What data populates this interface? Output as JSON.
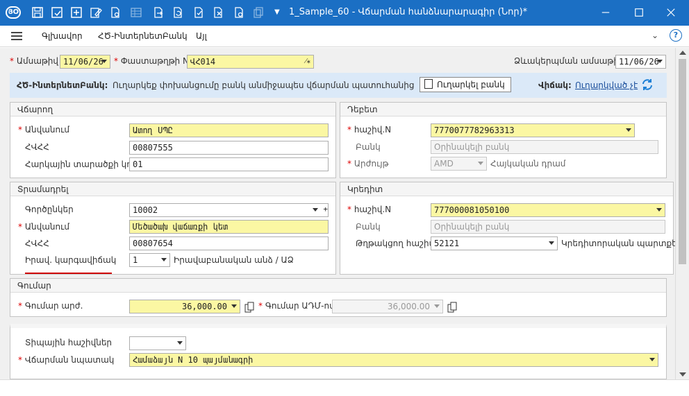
{
  "window": {
    "title": "1_Sample_60 - Վճարման հանձնարարագիր (Նոր)*",
    "logo_text": "ՅՕ"
  },
  "menu": {
    "items": [
      "Գլխավոր",
      "ՀԾ-ԻնտերնետԲանկ",
      "Այլ"
    ]
  },
  "header": {
    "date_label": "Ամսաթիվ",
    "date_value": "11/06/26",
    "doc_no_label": "Փաստաթղթի N",
    "doc_no_value": "ՎՀ014",
    "validity_label": "Ձևակերպման ամսաթիվ",
    "validity_value": "11/06/26"
  },
  "banner": {
    "title": "ՀԾ-ԻնտերնետԲանկ:",
    "text": "Ուղարկեք փոխանցումը բանկ անմիջապես վճարման պատուհանից",
    "send_button": "Ուղարկել բանկ",
    "status_label": "Վիճակ:",
    "status_value": "Ուղարկված չէ"
  },
  "payer": {
    "title": "Վճարող",
    "name_label": "Անվանում",
    "name_value": "Ատող ՍՊԸ",
    "tin_label": "ՀՎՀՀ",
    "tin_value": "00807555",
    "tax_label": "Հարկային տարածքի կոդ",
    "tax_value": "01"
  },
  "debit": {
    "title": "Դեբետ",
    "account_label": "հաշիվ.N",
    "account_value": "7770077782963313",
    "bank_label": "Բանկ",
    "bank_placeholder": "Օրինակելի բանկ",
    "currency_label": "Արժույթ",
    "currency_value": "AMD",
    "currency_name": "Հայկական դրամ"
  },
  "recipient": {
    "title": "Տրամադրել",
    "partner_label": "Գործընկեր",
    "partner_value": "10002",
    "name_label": "Անվանում",
    "name_value": "Մեծածախ վաճառքի կետ",
    "tin_label": "ՀՎՀՀ",
    "tin_value": "00807654",
    "legal_label": "Իրավ. կարգավիճակ",
    "legal_value": "1",
    "legal_text": "Իրավաբանական անձ / ԱՁ"
  },
  "credit": {
    "title": "Կրեդիտ",
    "account_label": "հաշիվ.N",
    "account_value": "777000081050100",
    "bank_label": "Բանկ",
    "bank_placeholder": "Օրինակելի բանկ",
    "corr_label": "Թղթակցող հաշիվ",
    "corr_value": "52121",
    "corr_text": "Կրեդիտորական պարտքեր"
  },
  "amount": {
    "title": "Գումար",
    "amount_label": "Գումար արժ.",
    "amount_value": "36,000.00",
    "amount_amd_label": "Գումար ԱԴՄ-ով",
    "amount_amd_value": "36,000.00"
  },
  "purpose": {
    "account_type_label": "Տիպային հաշիվներ",
    "account_type_value": "",
    "purpose_label": "Վճարման նպատակ",
    "purpose_value": "Համաձայն N 10 պայմանագրի"
  },
  "colors": {
    "titlebar": "#1b6fc4",
    "required_input": "#fbf7a3",
    "banner": "#dbe9f8",
    "required_mark": "#dd0000"
  }
}
